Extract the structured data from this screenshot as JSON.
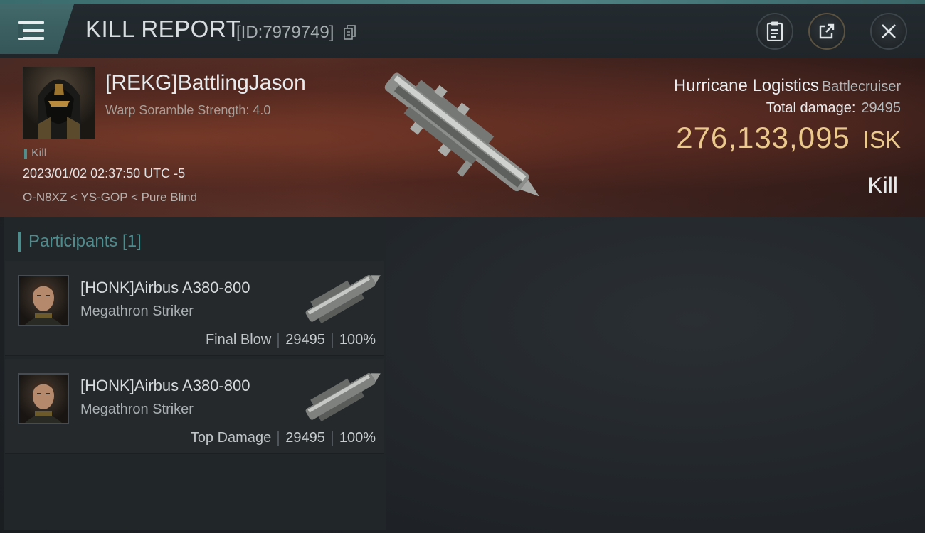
{
  "header": {
    "title": "KILL REPORT",
    "report_id": "[ID:7979749]"
  },
  "victim": {
    "name": "[REKG]BattlingJason",
    "warp_scramble": "Warp Soramble Strength: 4.0",
    "tag": "Kill",
    "datetime": "2023/01/02 02:37:50 UTC -5",
    "location": "O-N8XZ < YS-GOP < Pure Blind",
    "ship_name": "Hurricane Logistics",
    "ship_class": "Battlecruiser",
    "total_damage_label": "Total damage:",
    "total_damage": "29495",
    "isk_value": "276,133,095",
    "isk_unit": "ISK",
    "result": "Kill"
  },
  "participants": {
    "heading": "Participants [1]",
    "rows": [
      {
        "name": "[HONK]Airbus A380-800",
        "ship": "Megathron Striker",
        "role": "Final Blow",
        "damage": "29495",
        "percent": "100%"
      },
      {
        "name": "[HONK]Airbus A380-800",
        "ship": "Megathron Striker",
        "role": "Top Damage",
        "damage": "29495",
        "percent": "100%"
      }
    ]
  },
  "icons": {
    "menu": "hamburger-menu-icon",
    "copy": "copy-icon",
    "clipboard": "clipboard-icon",
    "share": "share-icon",
    "close": "close-icon"
  },
  "colors": {
    "accent_teal": "#4f8c8e",
    "isk_gold": "#ebc98d",
    "banner_red": "#5a3128"
  }
}
